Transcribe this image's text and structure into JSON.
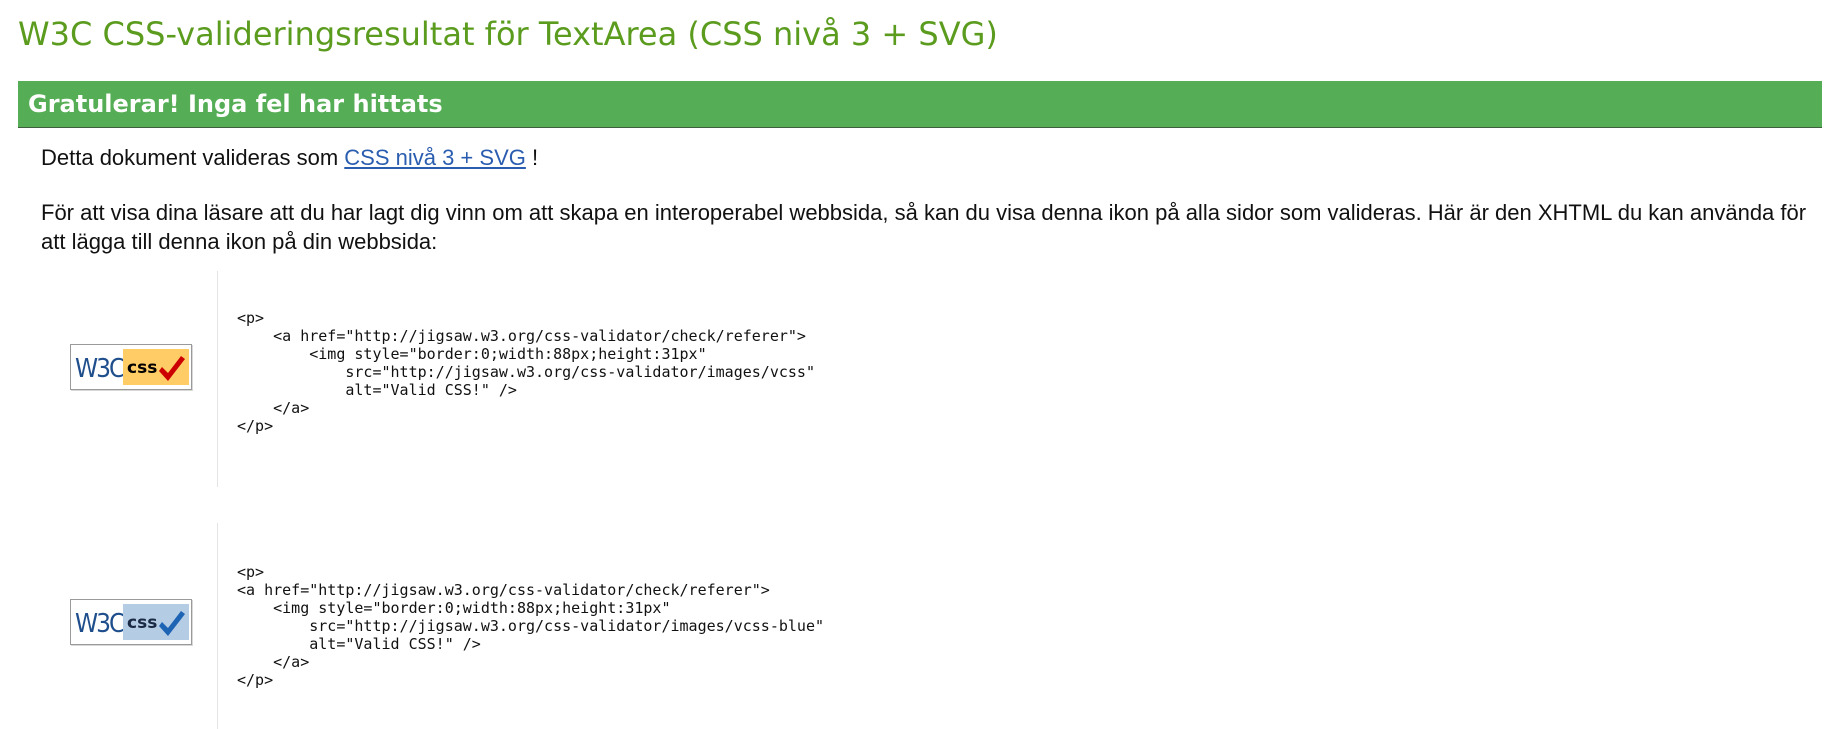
{
  "page": {
    "title": "W3C CSS-valideringsresultat för TextArea (CSS nivå 3 + SVG)"
  },
  "banner": {
    "text": "Gratulerar! Inga fel har hittats"
  },
  "intro": {
    "prefix": "Detta dokument valideras som ",
    "link_label": "CSS nivå 3 + SVG",
    "suffix": " !"
  },
  "info": {
    "text": "För att visa dina läsare att du har lagt dig vinn om att skapa en interoperabel webbsida, så kan du visa denna ikon på alla sidor som valideras. Här är den XHTML du kan använda för att lägga till denna ikon på din webbsida:"
  },
  "badges": [
    {
      "icon": "w3c-css-valid-badge-icon",
      "logo_text": "W3C",
      "css_text": "css",
      "color": "#ffcc66",
      "check_color": "#cc0000",
      "code": "<p>\n    <a href=\"http://jigsaw.w3.org/css-validator/check/referer\">\n        <img style=\"border:0;width:88px;height:31px\"\n            src=\"http://jigsaw.w3.org/css-validator/images/vcss\"\n            alt=\"Valid CSS!\" />\n    </a>\n</p>"
    },
    {
      "icon": "w3c-css-valid-blue-badge-icon",
      "logo_text": "W3C",
      "css_text": "css",
      "color": "#b4cce4",
      "check_color": "#1e64b4",
      "code": "<p>\n<a href=\"http://jigsaw.w3.org/css-validator/check/referer\">\n    <img style=\"border:0;width:88px;height:31px\"\n        src=\"http://jigsaw.w3.org/css-validator/images/vcss-blue\"\n        alt=\"Valid CSS!\" />\n    </a>\n</p>"
    }
  ],
  "colors": {
    "title": "#5b9c1f",
    "banner": "#55ae55",
    "link": "#2a5db0"
  }
}
